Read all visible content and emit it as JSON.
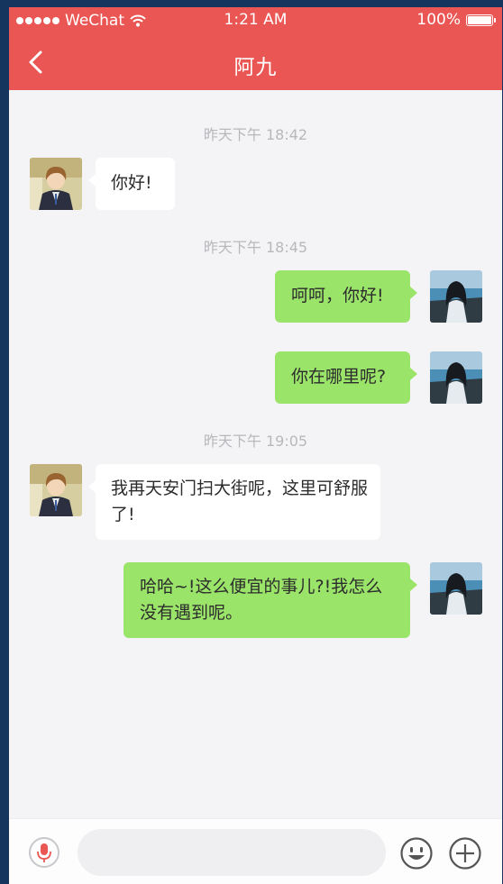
{
  "status_bar": {
    "carrier": "WeChat",
    "time": "1:21 AM",
    "battery": "100%"
  },
  "header": {
    "title": "阿九",
    "back_icon": "chevron-left-icon"
  },
  "messages": [
    {
      "type": "timestamp",
      "text": "昨天下午 18:42"
    },
    {
      "type": "incoming",
      "text": "你好!"
    },
    {
      "type": "timestamp",
      "text": "昨天下午 18:45"
    },
    {
      "type": "outgoing",
      "text": "呵呵，你好!"
    },
    {
      "type": "outgoing",
      "text": "你在哪里呢?"
    },
    {
      "type": "timestamp",
      "text": "昨天下午 19:05"
    },
    {
      "type": "incoming",
      "text": "我再天安门扫大街呢，这里可舒服了!"
    },
    {
      "type": "outgoing",
      "text": "哈哈~!这么便宜的事儿?!我怎么没有遇到呢。"
    }
  ],
  "input_bar": {
    "voice_icon": "microphone-icon",
    "input_value": "",
    "emoji_icon": "smiley-icon",
    "more_icon": "plus-icon"
  },
  "colors": {
    "header": "#e95653",
    "incoming_bubble": "#ffffff",
    "outgoing_bubble": "#9be46a",
    "background": "#f4f4f6"
  }
}
